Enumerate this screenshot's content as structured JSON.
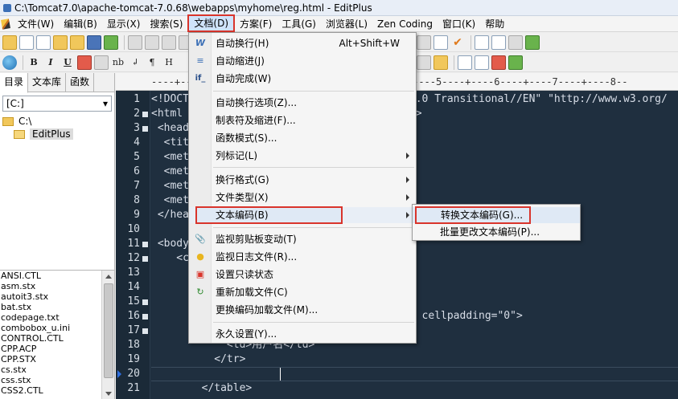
{
  "window": {
    "title": "C:\\Tomcat7.0\\apache-tomcat-7.0.68\\webapps\\myhome\\reg.html - EditPlus"
  },
  "menubar": {
    "items": [
      "文件(W)",
      "编辑(B)",
      "显示(X)",
      "搜索(S)",
      "文档(D)",
      "方案(F)",
      "工具(G)",
      "浏览器(L)",
      "Zen Coding",
      "窗口(K)",
      "帮助"
    ]
  },
  "toolbar2": {
    "bold": "B",
    "italic": "I",
    "underline": "U",
    "nbsp": "nb",
    "enter": "↲",
    "para": "¶",
    "heading": "H"
  },
  "left_panel": {
    "tabs": [
      "目录",
      "文本库",
      "函数"
    ],
    "drive": "[C:]",
    "folders": [
      "C:\\",
      "EditPlus"
    ],
    "files": [
      "ANSI.CTL",
      "asm.stx",
      "autoit3.stx",
      "bat.stx",
      "codepage.txt",
      "combobox_u.ini",
      "CONTROL.CTL",
      "CPP.ACP",
      "CPP.STX",
      "cs.stx",
      "css.stx",
      "CSS2.CTL"
    ]
  },
  "ruler": {
    "text": "----+----1----+----2----+----3----+----4----+----5----+----6----+----7----+----8--"
  },
  "editor": {
    "lines": [
      {
        "n": "1",
        "code": "<!DOCTYPE html PUBLIC \"-//W3C//DTD XHTML 1.0 Transitional//EN\" \"http://www.w3.org/",
        "fold": false
      },
      {
        "n": "2",
        "code": "<html xmlns=\"http://www.w3.org/1999/xhtml\">",
        "fold": true
      },
      {
        "n": "3",
        "code": " <head>",
        "fold": true
      },
      {
        "n": "4",
        "code": "  <title>",
        "fold": false
      },
      {
        "n": "5",
        "code": "  <meta                       ss\" />",
        "fold": false
      },
      {
        "n": "6",
        "code": "  <meta",
        "fold": false
      },
      {
        "n": "7",
        "code": "  <meta",
        "fold": false
      },
      {
        "n": "8",
        "code": "  <meta",
        "fold": false
      },
      {
        "n": "9",
        "code": " </head>",
        "fold": false
      },
      {
        "n": "10",
        "code": "",
        "fold": false
      },
      {
        "n": "11",
        "code": " <body>",
        "fold": true
      },
      {
        "n": "12",
        "code": "    <c",
        "fold": true
      },
      {
        "n": "13",
        "code": "",
        "fold": false
      },
      {
        "n": "14",
        "code": "",
        "fold": false
      },
      {
        "n": "15",
        "code": "",
        "fold": true
      },
      {
        "n": "16",
        "code": "                                  cing=\"0\" cellpadding=\"0\">",
        "fold": true
      },
      {
        "n": "17",
        "code": "",
        "fold": true
      },
      {
        "n": "18",
        "code": "            <td>用户名</td>",
        "fold": false
      },
      {
        "n": "19",
        "code": "          </tr>",
        "fold": false
      },
      {
        "n": "20",
        "code": "          ",
        "fold": false
      },
      {
        "n": "21",
        "code": "        </table>",
        "fold": false
      }
    ]
  },
  "dropdown": {
    "items": [
      {
        "label": "自动换行(H)",
        "shortcut": "Alt+Shift+W",
        "icon": "W",
        "submenu": false
      },
      {
        "label": "自动缩进(J)",
        "shortcut": "",
        "icon": "≡",
        "submenu": false
      },
      {
        "label": "自动完成(W)",
        "shortcut": "",
        "icon": "if_",
        "submenu": false
      },
      {
        "label": "自动换行选项(Z)...",
        "shortcut": "",
        "icon": "",
        "submenu": false
      },
      {
        "label": "制表符及缩进(F)...",
        "shortcut": "",
        "icon": "",
        "submenu": false
      },
      {
        "label": "函数模式(S)...",
        "shortcut": "",
        "icon": "",
        "submenu": false
      },
      {
        "label": "列标记(L)",
        "shortcut": "",
        "icon": "",
        "submenu": true
      },
      {
        "label": "换行格式(G)",
        "shortcut": "",
        "icon": "",
        "submenu": true
      },
      {
        "label": "文件类型(X)",
        "shortcut": "",
        "icon": "",
        "submenu": true
      },
      {
        "label": "文本编码(B)",
        "shortcut": "",
        "icon": "",
        "submenu": true
      },
      {
        "label": "监视剪贴板变动(T)",
        "shortcut": "",
        "icon": "clip",
        "submenu": false
      },
      {
        "label": "监视日志文件(R)...",
        "shortcut": "",
        "icon": "bulb",
        "submenu": false
      },
      {
        "label": "设置只读状态",
        "shortcut": "",
        "icon": "lock",
        "submenu": false
      },
      {
        "label": "重新加载文件(C)",
        "shortcut": "",
        "icon": "reload",
        "submenu": false
      },
      {
        "label": "更换编码加载文件(M)...",
        "shortcut": "",
        "icon": "",
        "submenu": false
      },
      {
        "label": "永久设置(Y)...",
        "shortcut": "",
        "icon": "",
        "submenu": false
      }
    ]
  },
  "submenu": {
    "items": [
      "转换文本编码(G)...",
      "批量更改文本编码(P)..."
    ]
  },
  "colors": {
    "highlight_border": "#d9342b",
    "editor_bg": "#1f2f3f"
  }
}
